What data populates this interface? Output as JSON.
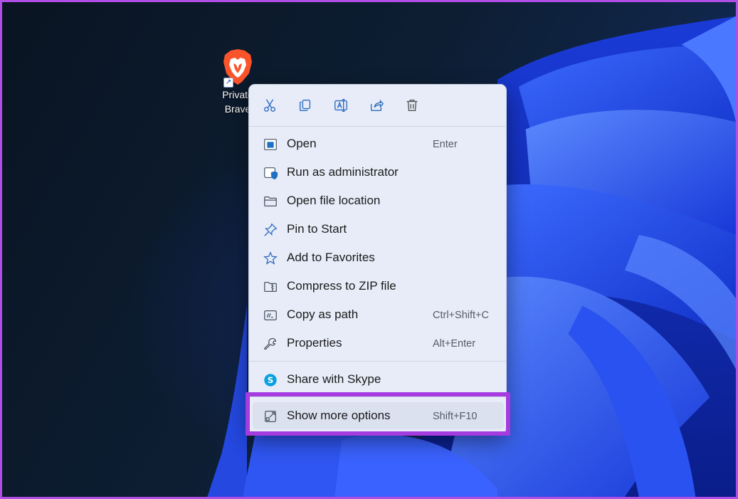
{
  "desktop": {
    "shortcut": {
      "label": "Private\nBrave",
      "icon": "brave-lion-icon",
      "overlay_icon": "shortcut-arrow-icon",
      "brand_color": "#fb542b"
    }
  },
  "context_menu": {
    "toolbar": [
      {
        "name": "cut",
        "icon": "scissors-icon"
      },
      {
        "name": "copy",
        "icon": "copy-icon"
      },
      {
        "name": "rename",
        "icon": "rename-icon"
      },
      {
        "name": "share",
        "icon": "share-icon"
      },
      {
        "name": "delete",
        "icon": "trash-icon"
      }
    ],
    "items": [
      {
        "label": "Open",
        "shortcut": "Enter",
        "icon": "open-window-icon"
      },
      {
        "label": "Run as administrator",
        "shortcut": "",
        "icon": "admin-shield-icon"
      },
      {
        "label": "Open file location",
        "shortcut": "",
        "icon": "folder-icon"
      },
      {
        "label": "Pin to Start",
        "shortcut": "",
        "icon": "pin-icon"
      },
      {
        "label": "Add to Favorites",
        "shortcut": "",
        "icon": "star-icon"
      },
      {
        "label": "Compress to ZIP file",
        "shortcut": "",
        "icon": "zip-folder-icon"
      },
      {
        "label": "Copy as path",
        "shortcut": "Ctrl+Shift+C",
        "icon": "copy-path-icon"
      },
      {
        "label": "Properties",
        "shortcut": "Alt+Enter",
        "icon": "wrench-icon"
      },
      {
        "label": "Share with Skype",
        "shortcut": "",
        "icon": "skype-icon"
      },
      {
        "label": "Show more options",
        "shortcut": "Shift+F10",
        "icon": "more-options-icon"
      }
    ]
  },
  "colors": {
    "accent": "#1f6fc4",
    "highlight_border": "#a43ce0",
    "skype": "#0aa0e0"
  }
}
